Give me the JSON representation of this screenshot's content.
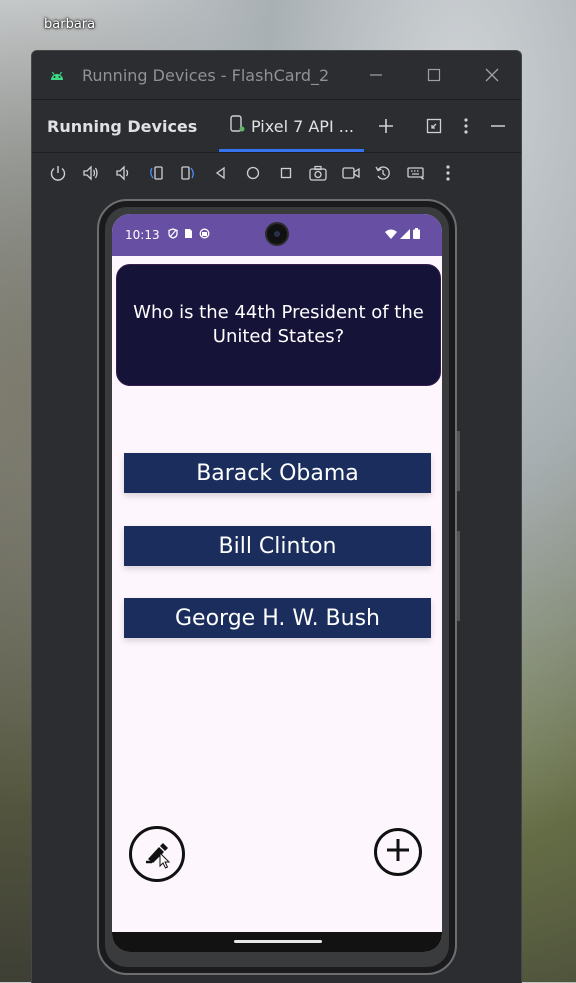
{
  "desktop": {
    "user_label": "barbara"
  },
  "window": {
    "title": "Running Devices - FlashCard_2",
    "tool_title": "Running Devices",
    "device_tab_label": "Pixel 7 API ..."
  },
  "phone": {
    "status_time": "10:13",
    "question": "Who is the 44th President of the United States?",
    "answers": [
      "Barack Obama",
      "Bill Clinton",
      "George H. W. Bush"
    ]
  },
  "colors": {
    "status_bar": "#6750a4",
    "question_card": "#161339",
    "answer_button": "#1a2d5c",
    "tab_underline": "#3574f0"
  },
  "icons": {
    "toolbar": [
      "power-icon",
      "volume-up-icon",
      "volume-down-icon",
      "rotate-left-icon",
      "rotate-right-icon",
      "back-icon",
      "home-icon",
      "overview-icon",
      "screenshot-icon",
      "screen-record-icon",
      "reset-icon",
      "keyboard-icon",
      "more-icon"
    ],
    "fab_left": "edit-icon",
    "fab_right": "add-icon"
  }
}
